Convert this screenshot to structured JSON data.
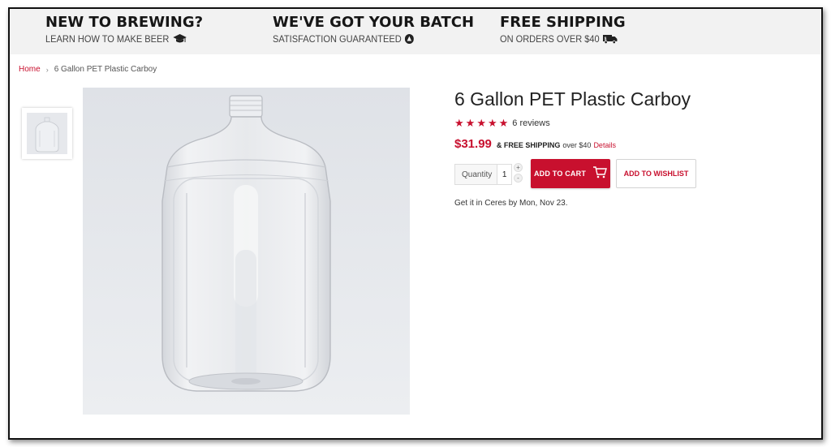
{
  "promo": {
    "items": [
      {
        "title": "NEW TO BREWING?",
        "subtitle": "LEARN HOW TO MAKE BEER",
        "icon": "graduation-cap-icon"
      },
      {
        "title": "WE'VE GOT YOUR BATCH",
        "subtitle": "SATISFACTION GUARANTEED",
        "icon": "badge-icon"
      },
      {
        "title": "FREE SHIPPING",
        "subtitle": "ON ORDERS OVER $40",
        "icon": "truck-icon"
      }
    ]
  },
  "breadcrumb": {
    "home": "Home",
    "separator": "›",
    "current": "6 Gallon PET Plastic Carboy"
  },
  "product": {
    "title": "6 Gallon PET Plastic Carboy",
    "rating": 5,
    "stars": [
      "★",
      "★",
      "★",
      "★",
      "★"
    ],
    "reviews": "6 reviews",
    "price": "$31.99",
    "shipping_strong": "& FREE SHIPPING",
    "shipping_text": "over $40",
    "shipping_link": "Details",
    "quantity_label": "Quantity",
    "quantity_value": "1",
    "qty_plus": "+",
    "qty_minus": "-",
    "add_to_cart": "ADD TO CART",
    "add_to_wishlist": "ADD TO WISHLIST",
    "delivery": "Get it in Ceres by Mon, Nov 23."
  },
  "colors": {
    "accent": "#c8102e",
    "banner_bg": "#f2f2f2",
    "image_bg": "#e4e6ea"
  }
}
